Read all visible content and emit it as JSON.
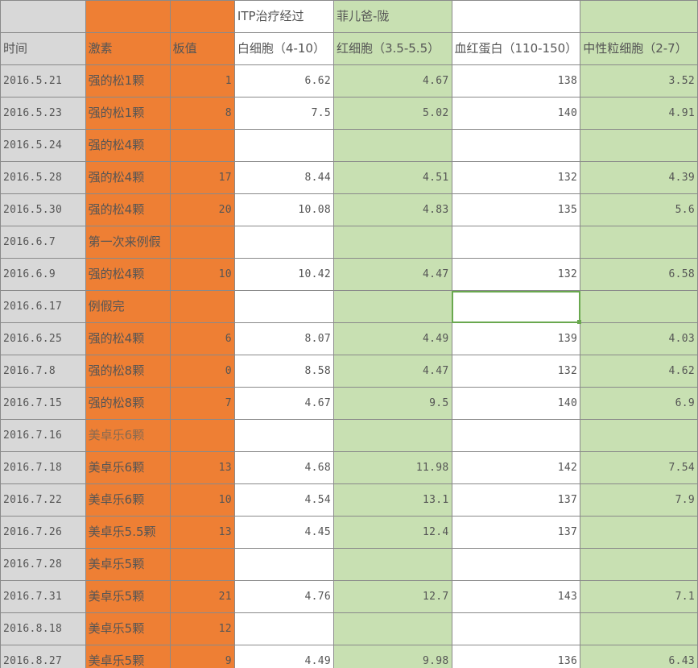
{
  "sheet": {
    "title_row": {
      "c": "ITP治疗经过",
      "d": "菲儿爸-陇"
    },
    "headers": [
      "时间",
      "激素",
      "板值",
      "白细胞（4-10）",
      "红细胞（3.5-5.5）",
      "血红蛋白（110-150）",
      "中性粒细胞（2-7）"
    ],
    "rows": [
      {
        "date": "2016.5.21",
        "drug": "强的松1颗",
        "plt": "1",
        "wbc": "6.62",
        "rbc": "4.67",
        "hgb": "138",
        "neu": "3.52"
      },
      {
        "date": "2016.5.23",
        "drug": "强的松1颗",
        "plt": "8",
        "wbc": "7.5",
        "rbc": "5.02",
        "hgb": "140",
        "neu": "4.91"
      },
      {
        "date": "2016.5.24",
        "drug": "强的松4颗",
        "plt": "",
        "wbc": "",
        "rbc": "",
        "hgb": "",
        "neu": ""
      },
      {
        "date": "2016.5.28",
        "drug": "强的松4颗",
        "plt": "17",
        "wbc": "8.44",
        "rbc": "4.51",
        "hgb": "132",
        "neu": "4.39"
      },
      {
        "date": "2016.5.30",
        "drug": "强的松4颗",
        "plt": "20",
        "wbc": "10.08",
        "rbc": "4.83",
        "hgb": "135",
        "neu": "5.6"
      },
      {
        "date": "2016.6.7",
        "drug": "第一次来例假",
        "plt": "",
        "wbc": "",
        "rbc": "",
        "hgb": "",
        "neu": ""
      },
      {
        "date": "2016.6.9",
        "drug": "强的松4颗",
        "plt": "10",
        "wbc": "10.42",
        "rbc": "4.47",
        "hgb": "132",
        "neu": "6.58"
      },
      {
        "date": "2016.6.17",
        "drug": "例假完",
        "plt": "",
        "wbc": "",
        "rbc": "",
        "hgb": "",
        "neu": ""
      },
      {
        "date": "2016.6.25",
        "drug": "强的松4颗",
        "plt": "6",
        "wbc": "8.07",
        "rbc": "4.49",
        "hgb": "139",
        "neu": "4.03"
      },
      {
        "date": "2016.7.8",
        "drug": "强的松8颗",
        "plt": "0",
        "wbc": "8.58",
        "rbc": "4.47",
        "hgb": "132",
        "neu": "4.62"
      },
      {
        "date": "2016.7.15",
        "drug": "强的松8颗",
        "plt": "7",
        "wbc": "4.67",
        "rbc": "9.5",
        "hgb": "140",
        "neu": "6.9"
      },
      {
        "date": "2016.7.16",
        "drug": "美卓乐6颗",
        "plt": "",
        "wbc": "",
        "rbc": "",
        "hgb": "",
        "neu": ""
      },
      {
        "date": "2016.7.18",
        "drug": "美卓乐6颗",
        "plt": "13",
        "wbc": "4.68",
        "rbc": "11.98",
        "hgb": "142",
        "neu": "7.54"
      },
      {
        "date": "2016.7.22",
        "drug": "美卓乐6颗",
        "plt": "10",
        "wbc": "4.54",
        "rbc": "13.1",
        "hgb": "137",
        "neu": "7.9"
      },
      {
        "date": "2016.7.26",
        "drug": "美卓乐5.5颗",
        "plt": "13",
        "wbc": "4.45",
        "rbc": "12.4",
        "hgb": "137",
        "neu": ""
      },
      {
        "date": "2016.7.28",
        "drug": "美卓乐5颗",
        "plt": "",
        "wbc": "",
        "rbc": "",
        "hgb": "",
        "neu": ""
      },
      {
        "date": "2016.7.31",
        "drug": "美卓乐5颗",
        "plt": "21",
        "wbc": "4.76",
        "rbc": "12.7",
        "hgb": "143",
        "neu": "7.1"
      },
      {
        "date": "2016.8.18",
        "drug": "美卓乐5颗",
        "plt": "12",
        "wbc": "",
        "rbc": "",
        "hgb": "",
        "neu": ""
      },
      {
        "date": "2016.8.27",
        "drug": "美卓乐5颗",
        "plt": "9",
        "wbc": "4.49",
        "rbc": "9.98",
        "hgb": "136",
        "neu": "6.43"
      }
    ],
    "selected_cell": {
      "row_date": "2016.6.17",
      "column": "血红蛋白（110-150）"
    },
    "colors": {
      "date": "#d8d8d8",
      "drug": "#ee7f34",
      "rbc_neu": "#c8e0b2",
      "selection": "#6aa84f"
    }
  }
}
